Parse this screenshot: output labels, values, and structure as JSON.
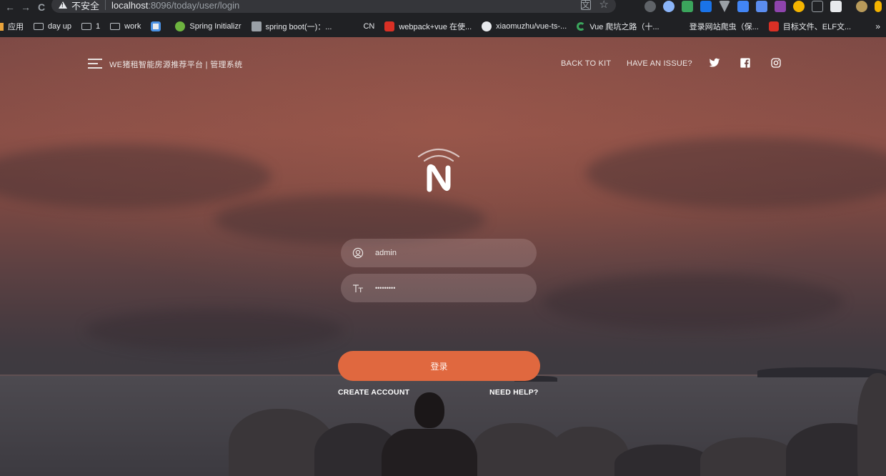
{
  "browser": {
    "insecure_label": "不安全",
    "url_host": "localhost",
    "url_path": ":8096/today/user/login",
    "bookmarks": [
      {
        "label": "应用",
        "icon": "apps-grid-icon"
      },
      {
        "label": "day up",
        "icon": "folder-icon"
      },
      {
        "label": "1",
        "icon": "folder-icon"
      },
      {
        "label": "work",
        "icon": "folder-icon"
      },
      {
        "label": "",
        "icon": "favicon-blue-icon"
      },
      {
        "label": "Spring Initializr",
        "icon": "spring-leaf-icon"
      },
      {
        "label": "spring boot(一)：...",
        "icon": "page-favicon-icon"
      },
      {
        "label": "CN",
        "icon": ""
      },
      {
        "label": "webpack+vue 在使...",
        "icon": "csdn-c-icon"
      },
      {
        "label": "xiaomuzhu/vue-ts-...",
        "icon": "github-icon"
      },
      {
        "label": "Vue 爬坑之路（十...",
        "icon": "green-c-icon"
      },
      {
        "label": "登录网站爬虫（保...",
        "icon": ""
      },
      {
        "label": "目标文件、ELF文...",
        "icon": "csdn-c-icon"
      }
    ],
    "more": "»"
  },
  "header": {
    "site_title": "WE猪租智能房源推荐平台 | 管理系统",
    "back_to_kit": "BACK TO KIT",
    "have_an_issue": "HAVE AN ISSUE?"
  },
  "login": {
    "username_value": "admin",
    "password_value": "•••••••••",
    "login_button": "登录",
    "create_account": "CREATE ACCOUNT",
    "need_help": "NEED HELP?"
  },
  "colors": {
    "accent": "#e0683f",
    "chrome_bg": "#202124"
  }
}
